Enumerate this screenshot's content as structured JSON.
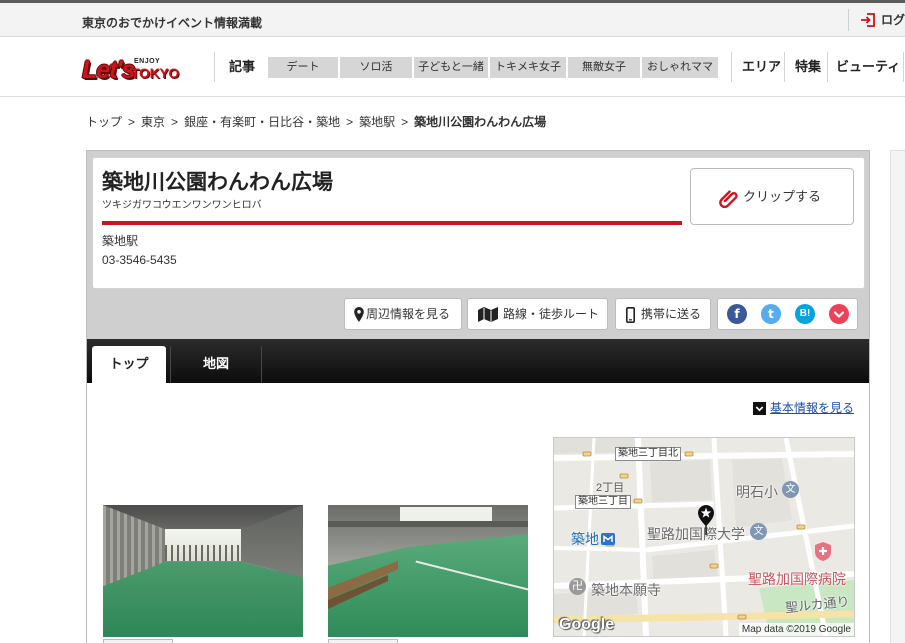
{
  "colors": {
    "accent_red": "#d0121b",
    "link_blue": "#1a4ea1",
    "facebook": "#3b5998",
    "twitter": "#55acee",
    "hatena": "#00a4de",
    "pocket": "#ee4056"
  },
  "top_bar": {
    "tagline": "東京のおでかけイベント情報満載",
    "login_label": "ログ",
    "login_icon": "login-icon"
  },
  "header": {
    "logo": {
      "main": "Let's",
      "small": "ENJOY",
      "city": "TOKYO"
    },
    "section_label": "記事",
    "categories": [
      "デート",
      "ソロ活",
      "子どもと一緒",
      "トキメキ女子",
      "無敵女子",
      "おしゃれママ"
    ],
    "links": [
      "エリア",
      "特集",
      "ビューティ"
    ]
  },
  "breadcrumb": {
    "separator": ">",
    "items": [
      "トップ",
      "東京",
      "銀座・有楽町・日比谷・築地",
      "築地駅",
      "築地川公園わんわん広場"
    ]
  },
  "spot": {
    "title": "築地川公園わんわん広場",
    "reading": "ツキジガワコウエンワンワンヒロバ",
    "station": "築地駅",
    "phone": "03-3546-5435"
  },
  "clip_button": {
    "label": "クリップする",
    "icon": "paperclip-icon"
  },
  "actions": [
    {
      "label": "周辺情報を見る",
      "icon": "map-pin-icon"
    },
    {
      "label": "路線・徒歩ルート",
      "icon": "route-map-icon"
    },
    {
      "label": "携帯に送る",
      "icon": "mobile-phone-icon"
    }
  ],
  "share": [
    {
      "icon": "facebook-icon",
      "glyph": "f"
    },
    {
      "icon": "twitter-icon",
      "glyph": "t"
    },
    {
      "icon": "hatena-bookmark-icon",
      "glyph": "B!"
    },
    {
      "icon": "pocket-icon"
    }
  ],
  "tabs": {
    "active_index": 0,
    "items": [
      "トップ",
      "地図"
    ]
  },
  "basic_info_link": {
    "label": "基本情報を見る",
    "icon": "chevron-down-box-icon"
  },
  "map": {
    "labels": {
      "tsukiji_3chome_kita": "築地三丁目北",
      "nichome": "2丁目",
      "tsukiji_3chome": "築地三丁目",
      "akashi_elementary": "明石小",
      "tsukiji_station": "築地",
      "st_lukes_university": "聖路加国際大学",
      "st_lukes_hospital": "聖路加国際病院",
      "tsukiji_honganji": "築地本願寺",
      "st_luke_street": "聖ルカ通り"
    },
    "school_glyph": "文",
    "temple_glyph": "卍",
    "logo": "Google",
    "attribution": "Map data ©2019 Google",
    "marker_icon": "map-marker-star-icon"
  }
}
